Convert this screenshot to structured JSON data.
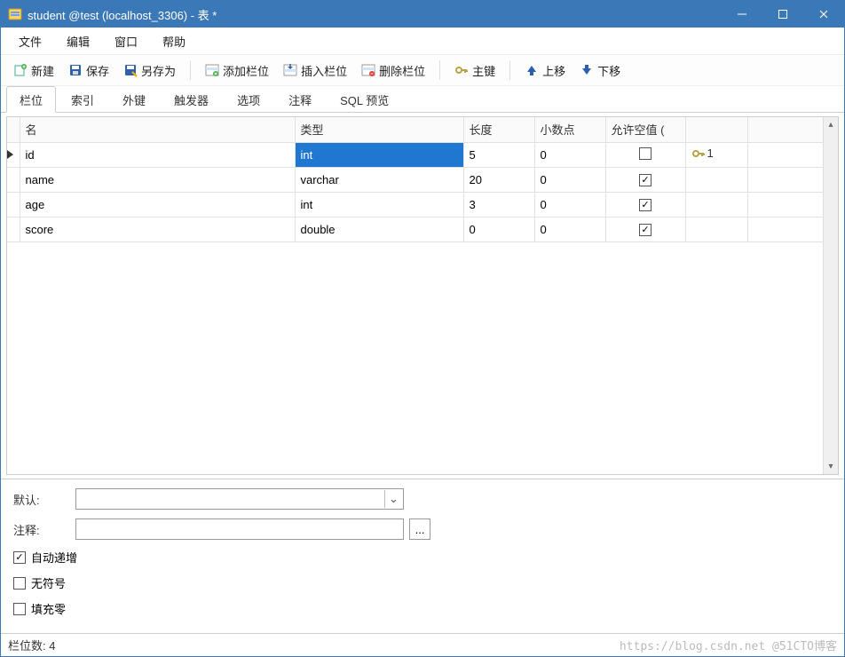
{
  "window": {
    "title": "student @test (localhost_3306) - 表 *"
  },
  "menu": {
    "file": "文件",
    "edit": "编辑",
    "window": "窗口",
    "help": "帮助"
  },
  "toolbar": {
    "new": "新建",
    "save": "保存",
    "save_as": "另存为",
    "add_field": "添加栏位",
    "insert_field": "插入栏位",
    "delete_field": "删除栏位",
    "primary_key": "主键",
    "move_up": "上移",
    "move_down": "下移"
  },
  "tabs": {
    "fields": "栏位",
    "indexes": "索引",
    "foreign_keys": "外键",
    "triggers": "触发器",
    "options": "选项",
    "comment": "注释",
    "sql_preview": "SQL 预览"
  },
  "grid": {
    "headers": {
      "name": "名",
      "type": "类型",
      "length": "长度",
      "decimals": "小数点",
      "allow_null": "允许空值 ("
    },
    "rows": [
      {
        "name": "id",
        "type": "int",
        "length": "5",
        "decimals": "0",
        "allow_null": false,
        "is_key": true,
        "key_num": "1",
        "current": true
      },
      {
        "name": "name",
        "type": "varchar",
        "length": "20",
        "decimals": "0",
        "allow_null": true,
        "is_key": false,
        "key_num": "",
        "current": false
      },
      {
        "name": "age",
        "type": "int",
        "length": "3",
        "decimals": "0",
        "allow_null": true,
        "is_key": false,
        "key_num": "",
        "current": false
      },
      {
        "name": "score",
        "type": "double",
        "length": "0",
        "decimals": "0",
        "allow_null": true,
        "is_key": false,
        "key_num": "",
        "current": false
      }
    ]
  },
  "props": {
    "default_label": "默认:",
    "default_value": "",
    "comment_label": "注释:",
    "comment_value": "",
    "auto_increment": "自动递增",
    "auto_increment_checked": true,
    "unsigned": "无符号",
    "unsigned_checked": false,
    "zerofill": "填充零",
    "zerofill_checked": false,
    "ellipsis": "..."
  },
  "status": {
    "field_count_label": "栏位数: 4",
    "watermark": "https://blog.csdn.net @51CTO博客"
  }
}
